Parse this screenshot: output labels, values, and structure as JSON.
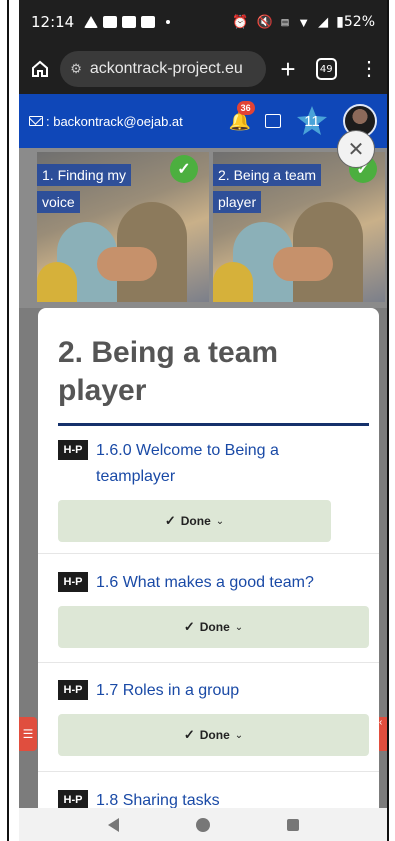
{
  "status_bar": {
    "time": "12:14",
    "battery": "52%",
    "icons": [
      "notification-icon",
      "app-icon",
      "app-icon",
      "app-icon",
      "alarm-icon",
      "mute-icon",
      "volte-icon",
      "wifi-icon",
      "signal-icon",
      "battery-icon"
    ]
  },
  "browser": {
    "url": "ackontrack-project.eu",
    "tab_count": "49"
  },
  "site_header": {
    "email_label": ": backontrack@oejab.at",
    "notification_count": "36",
    "level": "11"
  },
  "thumbnails": [
    {
      "label_line1": "1. Finding my",
      "label_line2": "voice"
    },
    {
      "label_line1": "2. Being a team",
      "label_line2": "player"
    }
  ],
  "modal": {
    "title_line1": "2. Being a team",
    "title_line2": "player",
    "badge_text": "H-P",
    "activities": [
      {
        "title": "1.6.0 Welcome to Being a teamplayer",
        "status": "Done"
      },
      {
        "title": "1.6 What makes a good team?",
        "status": "Done"
      },
      {
        "title": "1.7 Roles in a group",
        "status": "Done"
      },
      {
        "title": "1.8 Sharing tasks",
        "status": ""
      }
    ]
  },
  "colors": {
    "header_blue": "#0f47b8",
    "done_green": "#dde7d6",
    "check_green": "#4caf3f",
    "link_blue": "#1a4aa6"
  }
}
